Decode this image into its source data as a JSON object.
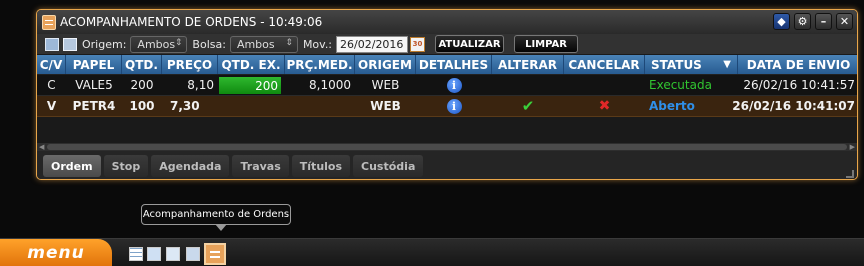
{
  "window": {
    "title": "ACOMPANHAMENTO DE ORDENS - 10:49:06"
  },
  "filters": {
    "origem_label": "Origem:",
    "origem_value": "Ambos",
    "bolsa_label": "Bolsa:",
    "bolsa_value": "Ambos",
    "mov_label": "Mov.:",
    "mov_value": "26/02/2016",
    "calendar_day": "30",
    "atualizar_label": "ATUALIZAR",
    "limpar_label": "LIMPAR"
  },
  "grid": {
    "columns": [
      "C/V",
      "PAPEL",
      "QTD.",
      "PREÇO",
      "QTD. EX.",
      "PRÇ.MED.",
      "ORIGEM",
      "DETALHES",
      "ALTERAR",
      "CANCELAR",
      "STATUS",
      "DATA DE ENVIO"
    ],
    "status_sort_indicator": "▼",
    "rows": [
      {
        "cv": "C",
        "papel": "VALE5",
        "qtd": "200",
        "preco": "8,10",
        "qtd_ex": "200",
        "prc_med": "8,1000",
        "origem": "WEB",
        "status": "Executada",
        "status_color": "#31c631",
        "data_envio": "26/02/16 10:41:57"
      },
      {
        "cv": "V",
        "papel": "PETR4",
        "qtd": "100",
        "preco": "7,30",
        "qtd_ex": "",
        "prc_med": "",
        "origem": "WEB",
        "status": "Aberto",
        "status_color": "#2f8fe8",
        "data_envio": "26/02/16 10:41:07"
      }
    ]
  },
  "tabs": [
    "Ordem",
    "Stop",
    "Agendada",
    "Travas",
    "Títulos",
    "Custódia"
  ],
  "active_tab": "Ordem",
  "tooltip": "Acompanhamento de Ordens",
  "taskbar": {
    "menu_label": "menu"
  }
}
